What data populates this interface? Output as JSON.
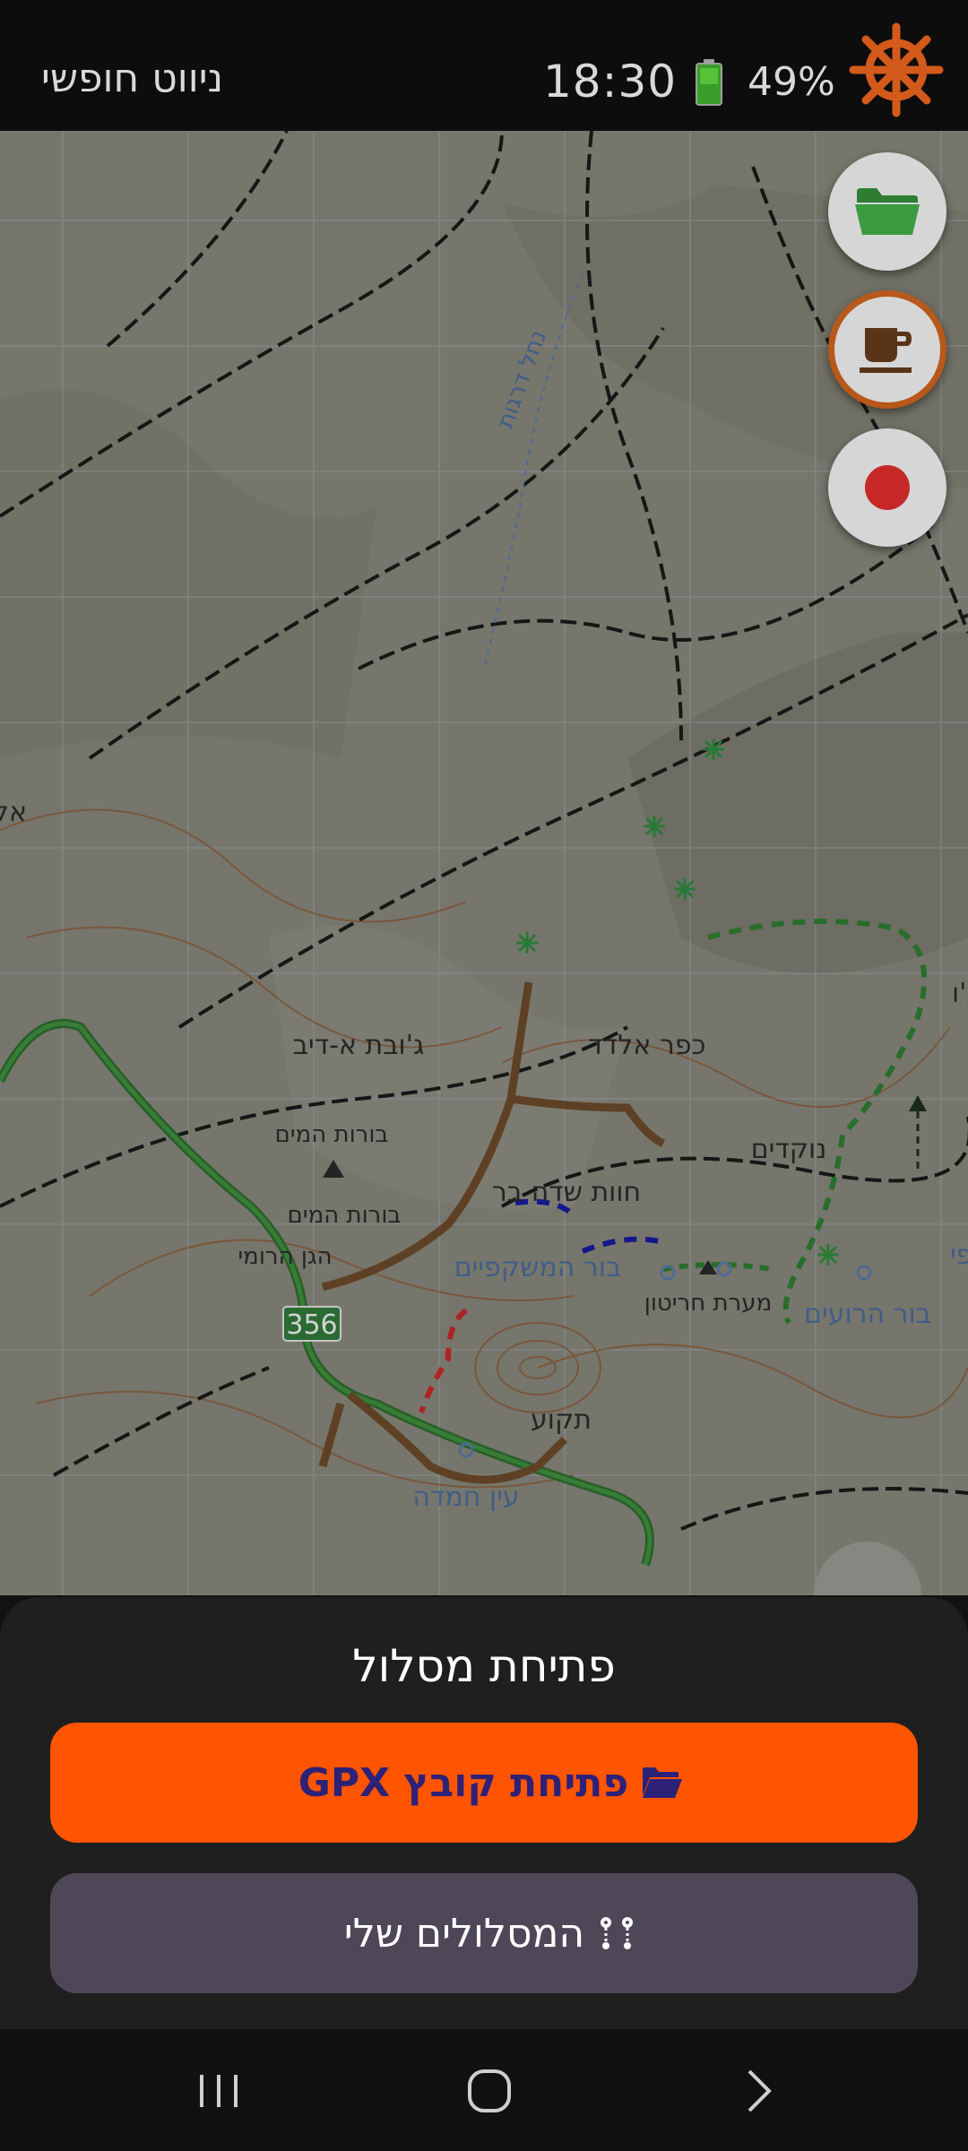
{
  "status_bar": {
    "app_title": "ניווט חופשי",
    "time": "18:30",
    "battery": "49%"
  },
  "map": {
    "labels": {
      "wadi": "נחל דרגות",
      "al_sh": "אל-ש",
      "jubat": "ג'ובת א-דיב",
      "kfar_eldad": "כפר אלדד",
      "borot_1": "בורות המים",
      "borot_2": "בורות המים",
      "hagan": "הגן הרומי",
      "havat": "חוות שדה בר",
      "nokdim": "נוקדים",
      "bor_mashkifim": "בור המשקפיים",
      "maarat": "מערת חריטון",
      "bor_roim": "בור הרועים",
      "tekoa": "תקוע",
      "ein": "עין חמדה",
      "road": "356",
      "edge_right1": "מפי",
      "edge_right2": "ע'ו"
    }
  },
  "fabs": [
    {
      "icon": "folder-icon"
    },
    {
      "icon": "coffee-cup-icon"
    },
    {
      "icon": "record-icon"
    }
  ],
  "sheet": {
    "title": "פתיחת מסלול",
    "open_gpx_label": "פתיחת קובץ GPX",
    "my_tracks_label": "המסלולים שלי"
  },
  "colors": {
    "accent": "#ff5400",
    "secondary_button": "#4d4758",
    "helm": "#d35a1a",
    "record": "#c62828"
  }
}
